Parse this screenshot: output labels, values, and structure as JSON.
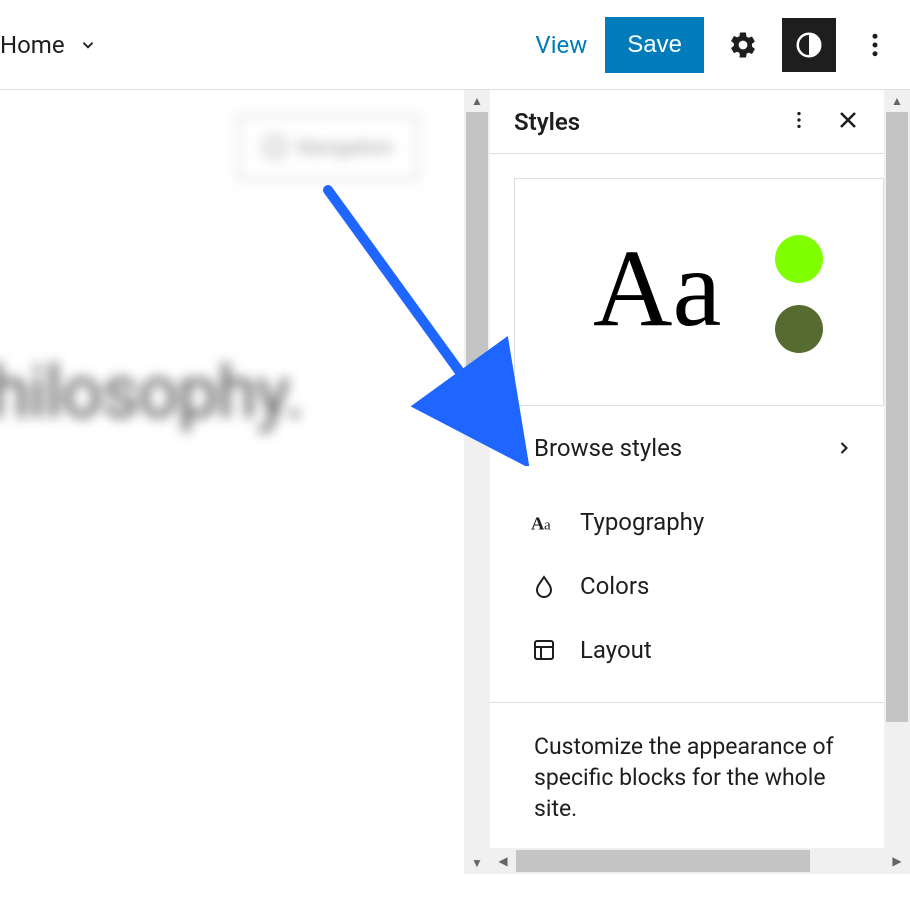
{
  "topbar": {
    "home_label": "Home",
    "view_label": "View",
    "save_label": "Save"
  },
  "canvas": {
    "navigation_block_label": "Navigation",
    "hero_text": "hilosophy."
  },
  "sidebar": {
    "panel_title": "Styles",
    "preview_sample": "Aa",
    "swatch_colors": {
      "primary": "#7fff00",
      "secondary": "#556b2f"
    },
    "browse_label": "Browse styles",
    "categories": [
      {
        "icon": "typography-icon",
        "label": "Typography"
      },
      {
        "icon": "colors-icon",
        "label": "Colors"
      },
      {
        "icon": "layout-icon",
        "label": "Layout"
      }
    ],
    "blocks_description": "Customize the appearance of specific blocks for the whole site."
  }
}
